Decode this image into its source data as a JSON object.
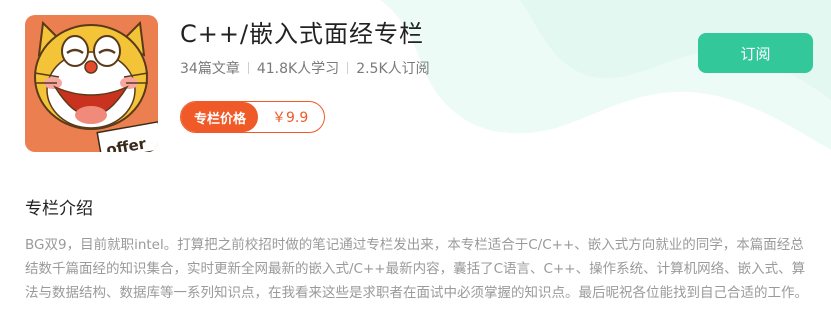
{
  "column": {
    "title": "C++/嵌入式面经专栏",
    "stats": {
      "articles": "34篇文章",
      "learners": "41.8K人学习",
      "subscribers": "2.5K人订阅"
    },
    "price": {
      "label": "专栏价格",
      "value": "￥9.9"
    },
    "subscribe_label": "订阅",
    "cover": {
      "text": "offer",
      "alt_icon": "cat-cartoon-cover-icon"
    }
  },
  "intro": {
    "heading": "专栏介绍",
    "text": "BG双9，目前就职intel。打算把之前校招时做的笔记通过专栏发出来，本专栏适合于C/C++、嵌入式方向就业的同学，本篇面经总结数千篇面经的知识集合，实时更新全网最新的嵌入式/C++最新内容，囊括了C语言、C++、操作系统、计算机网络、嵌入式、算法与数据结构、数据库等一系列知识点，在我看来这些是求职者在面试中必须掌握的知识点。最后昵祝各位能找到自己合适的工作。"
  },
  "colors": {
    "accent_green": "#32c89a",
    "price_orange": "#f05a28",
    "bg_wave": "#e9faf4"
  }
}
